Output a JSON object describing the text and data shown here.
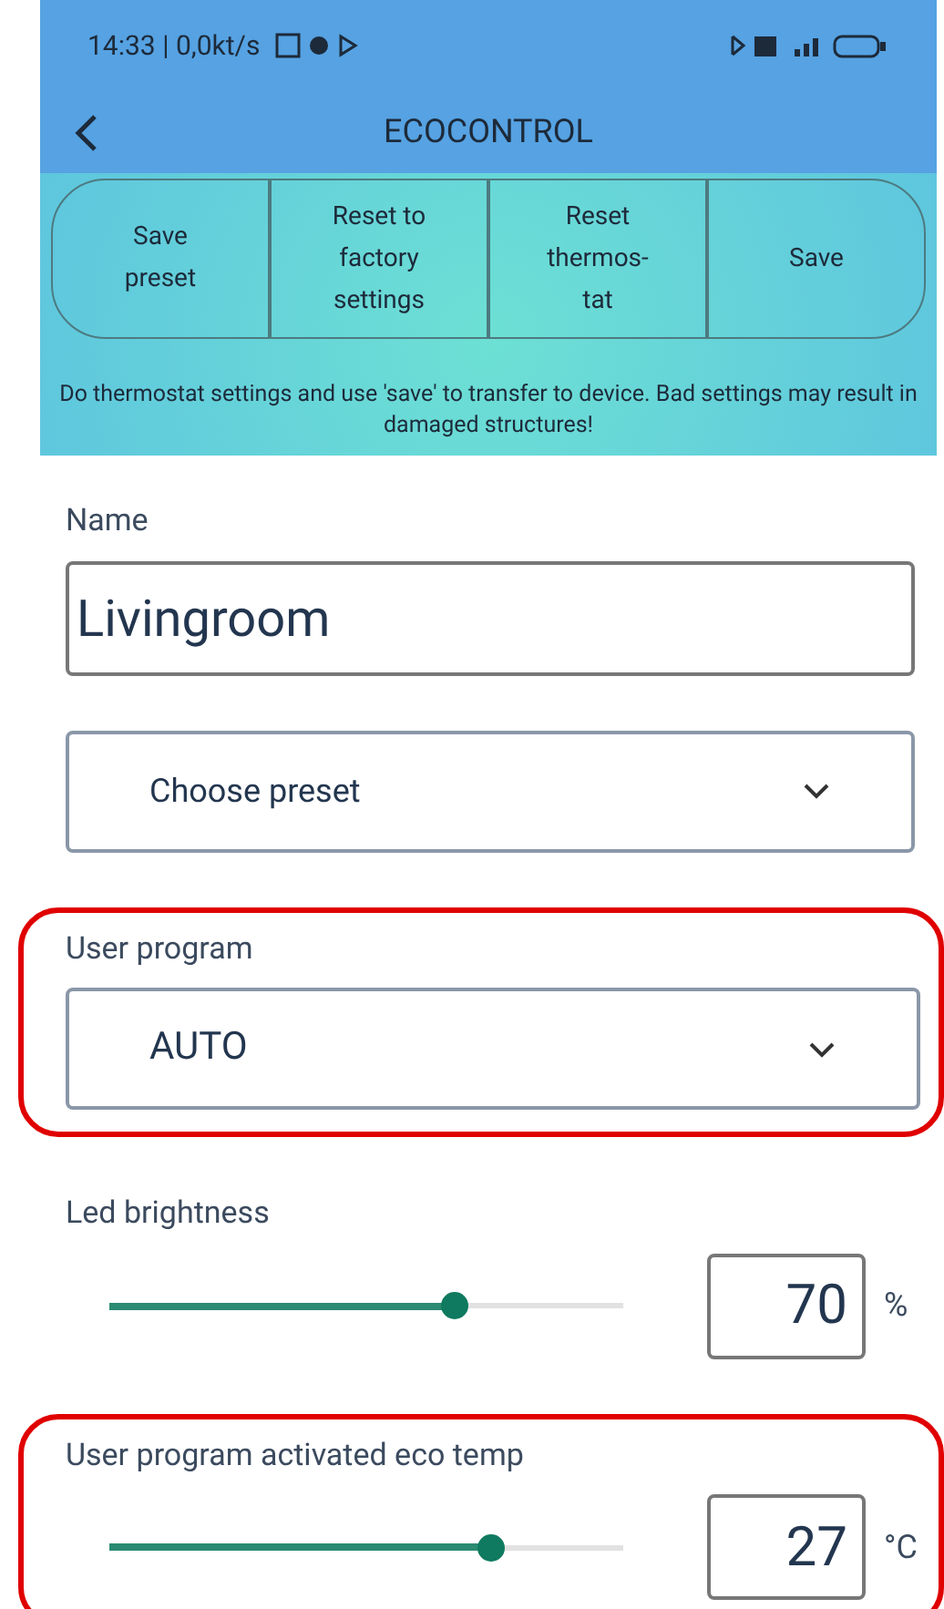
{
  "status_bar": {
    "time": "14:33 | 0,0kt/s"
  },
  "header": {
    "title": "ECOCONTROL"
  },
  "toolbar": {
    "buttons": [
      "Save preset",
      "Reset to factory settings",
      "Reset thermos-tat",
      "Save"
    ],
    "notice": "Do thermostat settings and use 'save' to transfer to device. Bad settings may result in damaged structures!"
  },
  "fields": [
    {
      "kind": "text",
      "label": "Name",
      "value": "Livingroom",
      "highlighted": false
    },
    {
      "kind": "select",
      "value": "Choose preset",
      "highlighted": false
    },
    {
      "kind": "select",
      "label": "User program",
      "value": "AUTO",
      "highlighted": true
    },
    {
      "kind": "slider",
      "label": "Led brightness",
      "level": 0.67,
      "value": "70",
      "unit": "%",
      "highlighted": false
    },
    {
      "kind": "slider",
      "label": "User program activated eco temp",
      "level": 0.74,
      "value": "27",
      "unit": "°C",
      "highlighted": true
    }
  ]
}
